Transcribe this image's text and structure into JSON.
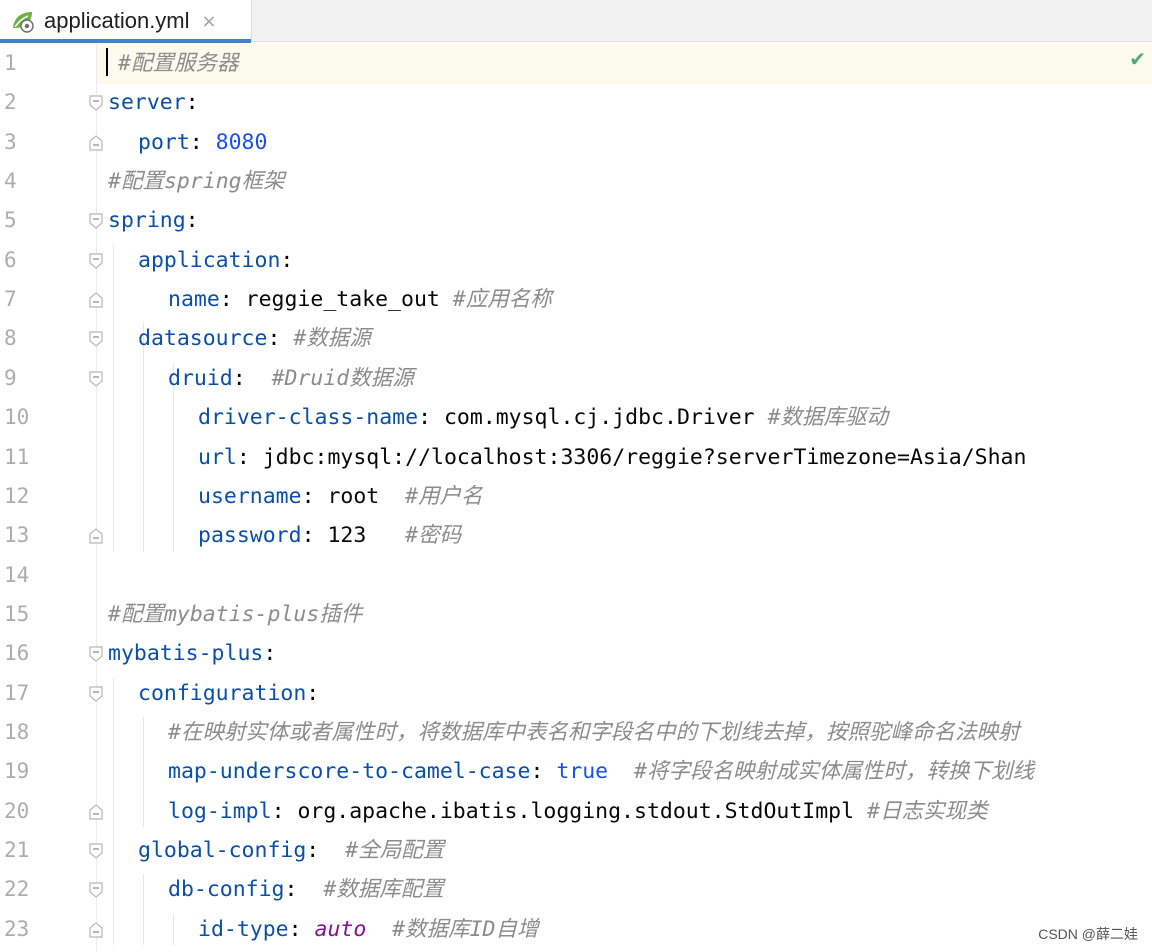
{
  "tab": {
    "filename": "application.yml",
    "close": "×",
    "icon": "yaml-file-icon"
  },
  "status": {
    "inspection_icon": "checkmark-icon",
    "inspection_symbol": "✔"
  },
  "watermark": "CSDN @薛二娃",
  "lines": [
    {
      "n": "1",
      "ind": 0,
      "parts": [
        [
          "c",
          "#配置服务器"
        ]
      ]
    },
    {
      "n": "2",
      "ind": 0,
      "parts": [
        [
          "k",
          "server"
        ],
        [
          "p",
          ":"
        ]
      ]
    },
    {
      "n": "3",
      "ind": 1,
      "parts": [
        [
          "k",
          "port"
        ],
        [
          "p",
          ": "
        ],
        [
          "n",
          "8080"
        ]
      ]
    },
    {
      "n": "4",
      "ind": 0,
      "parts": [
        [
          "c",
          "#配置spring框架"
        ]
      ]
    },
    {
      "n": "5",
      "ind": 0,
      "parts": [
        [
          "k",
          "spring"
        ],
        [
          "p",
          ":"
        ]
      ]
    },
    {
      "n": "6",
      "ind": 1,
      "parts": [
        [
          "k",
          "application"
        ],
        [
          "p",
          ":"
        ]
      ]
    },
    {
      "n": "7",
      "ind": 2,
      "parts": [
        [
          "k",
          "name"
        ],
        [
          "p",
          ": "
        ],
        [
          "v",
          "reggie_take_out "
        ],
        [
          "c",
          "#应用名称"
        ]
      ]
    },
    {
      "n": "8",
      "ind": 1,
      "parts": [
        [
          "k",
          "datasource"
        ],
        [
          "p",
          ": "
        ],
        [
          "c",
          "#数据源"
        ]
      ]
    },
    {
      "n": "9",
      "ind": 2,
      "parts": [
        [
          "k",
          "druid"
        ],
        [
          "p",
          ":  "
        ],
        [
          "c",
          "#Druid数据源"
        ]
      ]
    },
    {
      "n": "10",
      "ind": 3,
      "parts": [
        [
          "k",
          "driver-class-name"
        ],
        [
          "p",
          ": "
        ],
        [
          "v",
          "com.mysql.cj.jdbc.Driver "
        ],
        [
          "c",
          "#数据库驱动"
        ]
      ]
    },
    {
      "n": "11",
      "ind": 3,
      "parts": [
        [
          "k",
          "url"
        ],
        [
          "p",
          ": "
        ],
        [
          "v",
          "jdbc:mysql://localhost:3306/reggie?serverTimezone=Asia/Shan"
        ]
      ]
    },
    {
      "n": "12",
      "ind": 3,
      "parts": [
        [
          "k",
          "username"
        ],
        [
          "p",
          ": "
        ],
        [
          "v",
          "root  "
        ],
        [
          "c",
          "#用户名"
        ]
      ]
    },
    {
      "n": "13",
      "ind": 3,
      "parts": [
        [
          "k",
          "password"
        ],
        [
          "p",
          ": "
        ],
        [
          "v",
          "123   "
        ],
        [
          "c",
          "#密码"
        ]
      ]
    },
    {
      "n": "14",
      "ind": 0,
      "parts": []
    },
    {
      "n": "15",
      "ind": 0,
      "parts": [
        [
          "c",
          "#配置mybatis-plus插件"
        ]
      ]
    },
    {
      "n": "16",
      "ind": 0,
      "parts": [
        [
          "k",
          "mybatis-plus"
        ],
        [
          "p",
          ":"
        ]
      ]
    },
    {
      "n": "17",
      "ind": 1,
      "parts": [
        [
          "k",
          "configuration"
        ],
        [
          "p",
          ":"
        ]
      ]
    },
    {
      "n": "18",
      "ind": 2,
      "parts": [
        [
          "c",
          "#在映射实体或者属性时，将数据库中表名和字段名中的下划线去掉，按照驼峰命名法映射"
        ]
      ]
    },
    {
      "n": "19",
      "ind": 2,
      "parts": [
        [
          "k",
          "map-underscore-to-camel-case"
        ],
        [
          "p",
          ": "
        ],
        [
          "n",
          "true  "
        ],
        [
          "c",
          "#将字段名映射成实体属性时，转换下划线"
        ]
      ]
    },
    {
      "n": "20",
      "ind": 2,
      "parts": [
        [
          "k",
          "log-impl"
        ],
        [
          "p",
          ": "
        ],
        [
          "v",
          "org.apache.ibatis.logging.stdout.StdOutImpl "
        ],
        [
          "c",
          "#日志实现类"
        ]
      ]
    },
    {
      "n": "21",
      "ind": 1,
      "parts": [
        [
          "k",
          "global-config"
        ],
        [
          "p",
          ":  "
        ],
        [
          "c",
          "#全局配置"
        ]
      ]
    },
    {
      "n": "22",
      "ind": 2,
      "parts": [
        [
          "k",
          "db-config"
        ],
        [
          "p",
          ":  "
        ],
        [
          "c",
          "#数据库配置"
        ]
      ]
    },
    {
      "n": "23",
      "ind": 3,
      "parts": [
        [
          "k",
          "id-type"
        ],
        [
          "p",
          ": "
        ],
        [
          "kw",
          "auto  "
        ],
        [
          "c",
          "#数据库ID自增"
        ]
      ]
    }
  ]
}
